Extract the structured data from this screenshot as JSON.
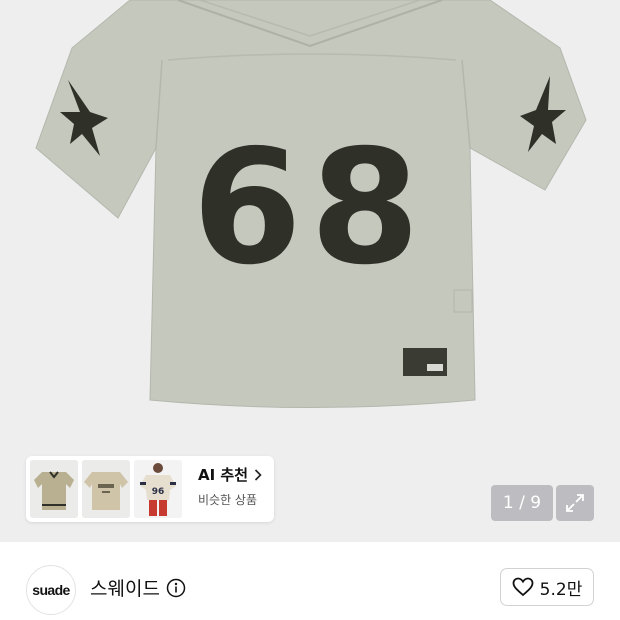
{
  "product": {
    "jersey_number": "68",
    "image_counter": "1 / 9"
  },
  "recommendation": {
    "title": "AI 추천",
    "subtitle": "비슷한 상품",
    "thumbnails": [
      {
        "name": "army-jersey-ringer"
      },
      {
        "name": "army-tee-flat"
      },
      {
        "name": "model-wearing-96-jersey",
        "number": "96"
      }
    ]
  },
  "brand": {
    "logo_text": "suade",
    "name": "스웨이드"
  },
  "like": {
    "count": "5.2만"
  },
  "icons": {
    "expand": "expand-icon",
    "info": "info-icon",
    "heart": "heart-icon",
    "chevron": "chevron-right-icon"
  },
  "colors": {
    "jersey": "#c4c8bd",
    "print": "#2f3028",
    "hero_bg": "#eeeeef"
  }
}
